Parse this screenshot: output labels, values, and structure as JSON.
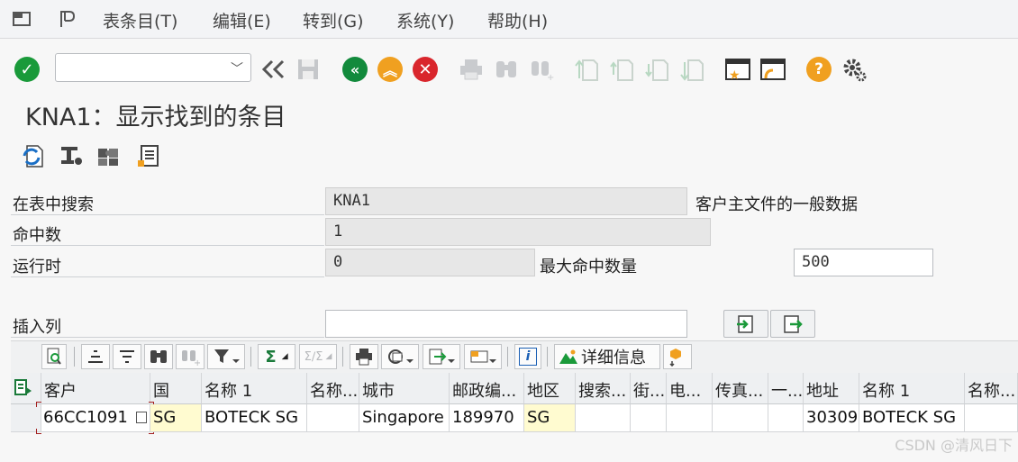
{
  "menu": {
    "items": [
      {
        "label": "表条目(T)"
      },
      {
        "label": "编辑(E)"
      },
      {
        "label": "转到(G)"
      },
      {
        "label": "系统(Y)"
      },
      {
        "label": "帮助(H)"
      }
    ]
  },
  "toolbar": {
    "command_value": ""
  },
  "title": "KNA1：显示找到的条目",
  "form": {
    "search_in_table_label": "在表中搜索",
    "table_name": "KNA1",
    "table_desc": "客户主文件的一般数据",
    "hits_label": "命中数",
    "hits_value": "1",
    "runtime_label": "运行时",
    "runtime_value": "0",
    "max_hits_label": "最大命中数量",
    "max_hits_value": "500",
    "insert_col_label": "插入列",
    "insert_col_value": ""
  },
  "alv": {
    "details_label": "详细信息"
  },
  "grid": {
    "columns": [
      "客户",
      "国",
      "名称 1",
      "名称...",
      "城市",
      "邮政编...",
      "地区",
      "搜索...",
      "街...",
      "电...",
      "传真...",
      "一...",
      "地址",
      "名称 1",
      "名称..."
    ],
    "rows": [
      [
        "66CC1091",
        "SG",
        "BOTECK SG",
        "",
        "Singapore",
        "189970",
        "SG",
        "",
        "",
        "",
        "",
        "",
        "30309",
        "BOTECK SG",
        ""
      ]
    ]
  },
  "watermark": "CSDN @清风日下",
  "colors": {
    "check_green": "#1a9a3a",
    "nav_green": "#128a3c",
    "nav_orange": "#f0a020",
    "cancel_red": "#d9262c",
    "help_orange": "#f0a020",
    "key_yellow": "#fffbd0"
  }
}
